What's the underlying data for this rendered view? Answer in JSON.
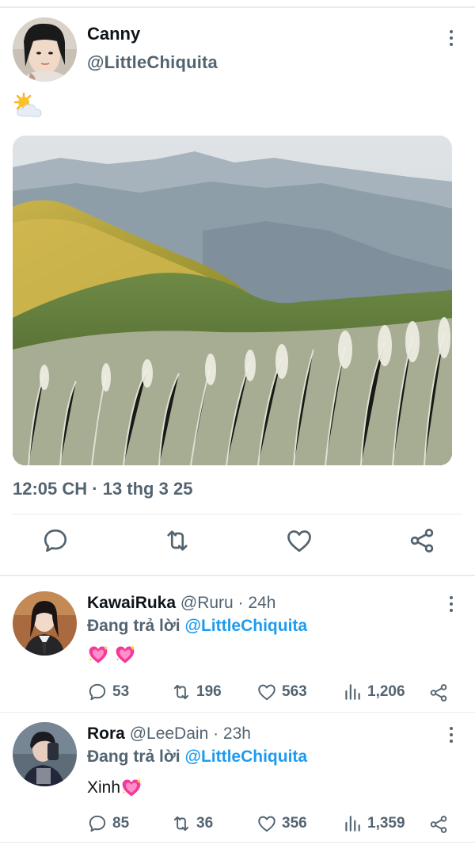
{
  "main_tweet": {
    "author_name": "Canny",
    "handle": "@LittleChiquita",
    "text_emoji": "sun-behind-cloud-emoji",
    "timestamp": "12:05 CH · 13 thg 3 25",
    "actions": [
      "reply-icon",
      "retweet-icon",
      "like-icon",
      "share-icon"
    ]
  },
  "replies": [
    {
      "author_name": "KawaiRuka",
      "handle_time": "@Ruru · 24h",
      "replying_prefix": "Đang trả lời",
      "replying_to": "@LittleChiquita",
      "text": "",
      "emoji": "sparkling-heart-emoji x2",
      "stats": {
        "replies": "53",
        "retweets": "196",
        "likes": "563",
        "views": "1,206"
      }
    },
    {
      "author_name": "Rora",
      "handle_time": "@LeeDain · 23h",
      "replying_prefix": "Đang trả lời",
      "replying_to": "@LittleChiquita",
      "text": "Xinh",
      "emoji": "sparkling-heart-emoji",
      "stats": {
        "replies": "85",
        "retweets": "36",
        "likes": "356",
        "views": "1,359"
      }
    }
  ],
  "colors": {
    "accent": "#1d9bf0",
    "muted": "#536471",
    "divider": "#e6ecf0",
    "text": "#0f1419"
  }
}
